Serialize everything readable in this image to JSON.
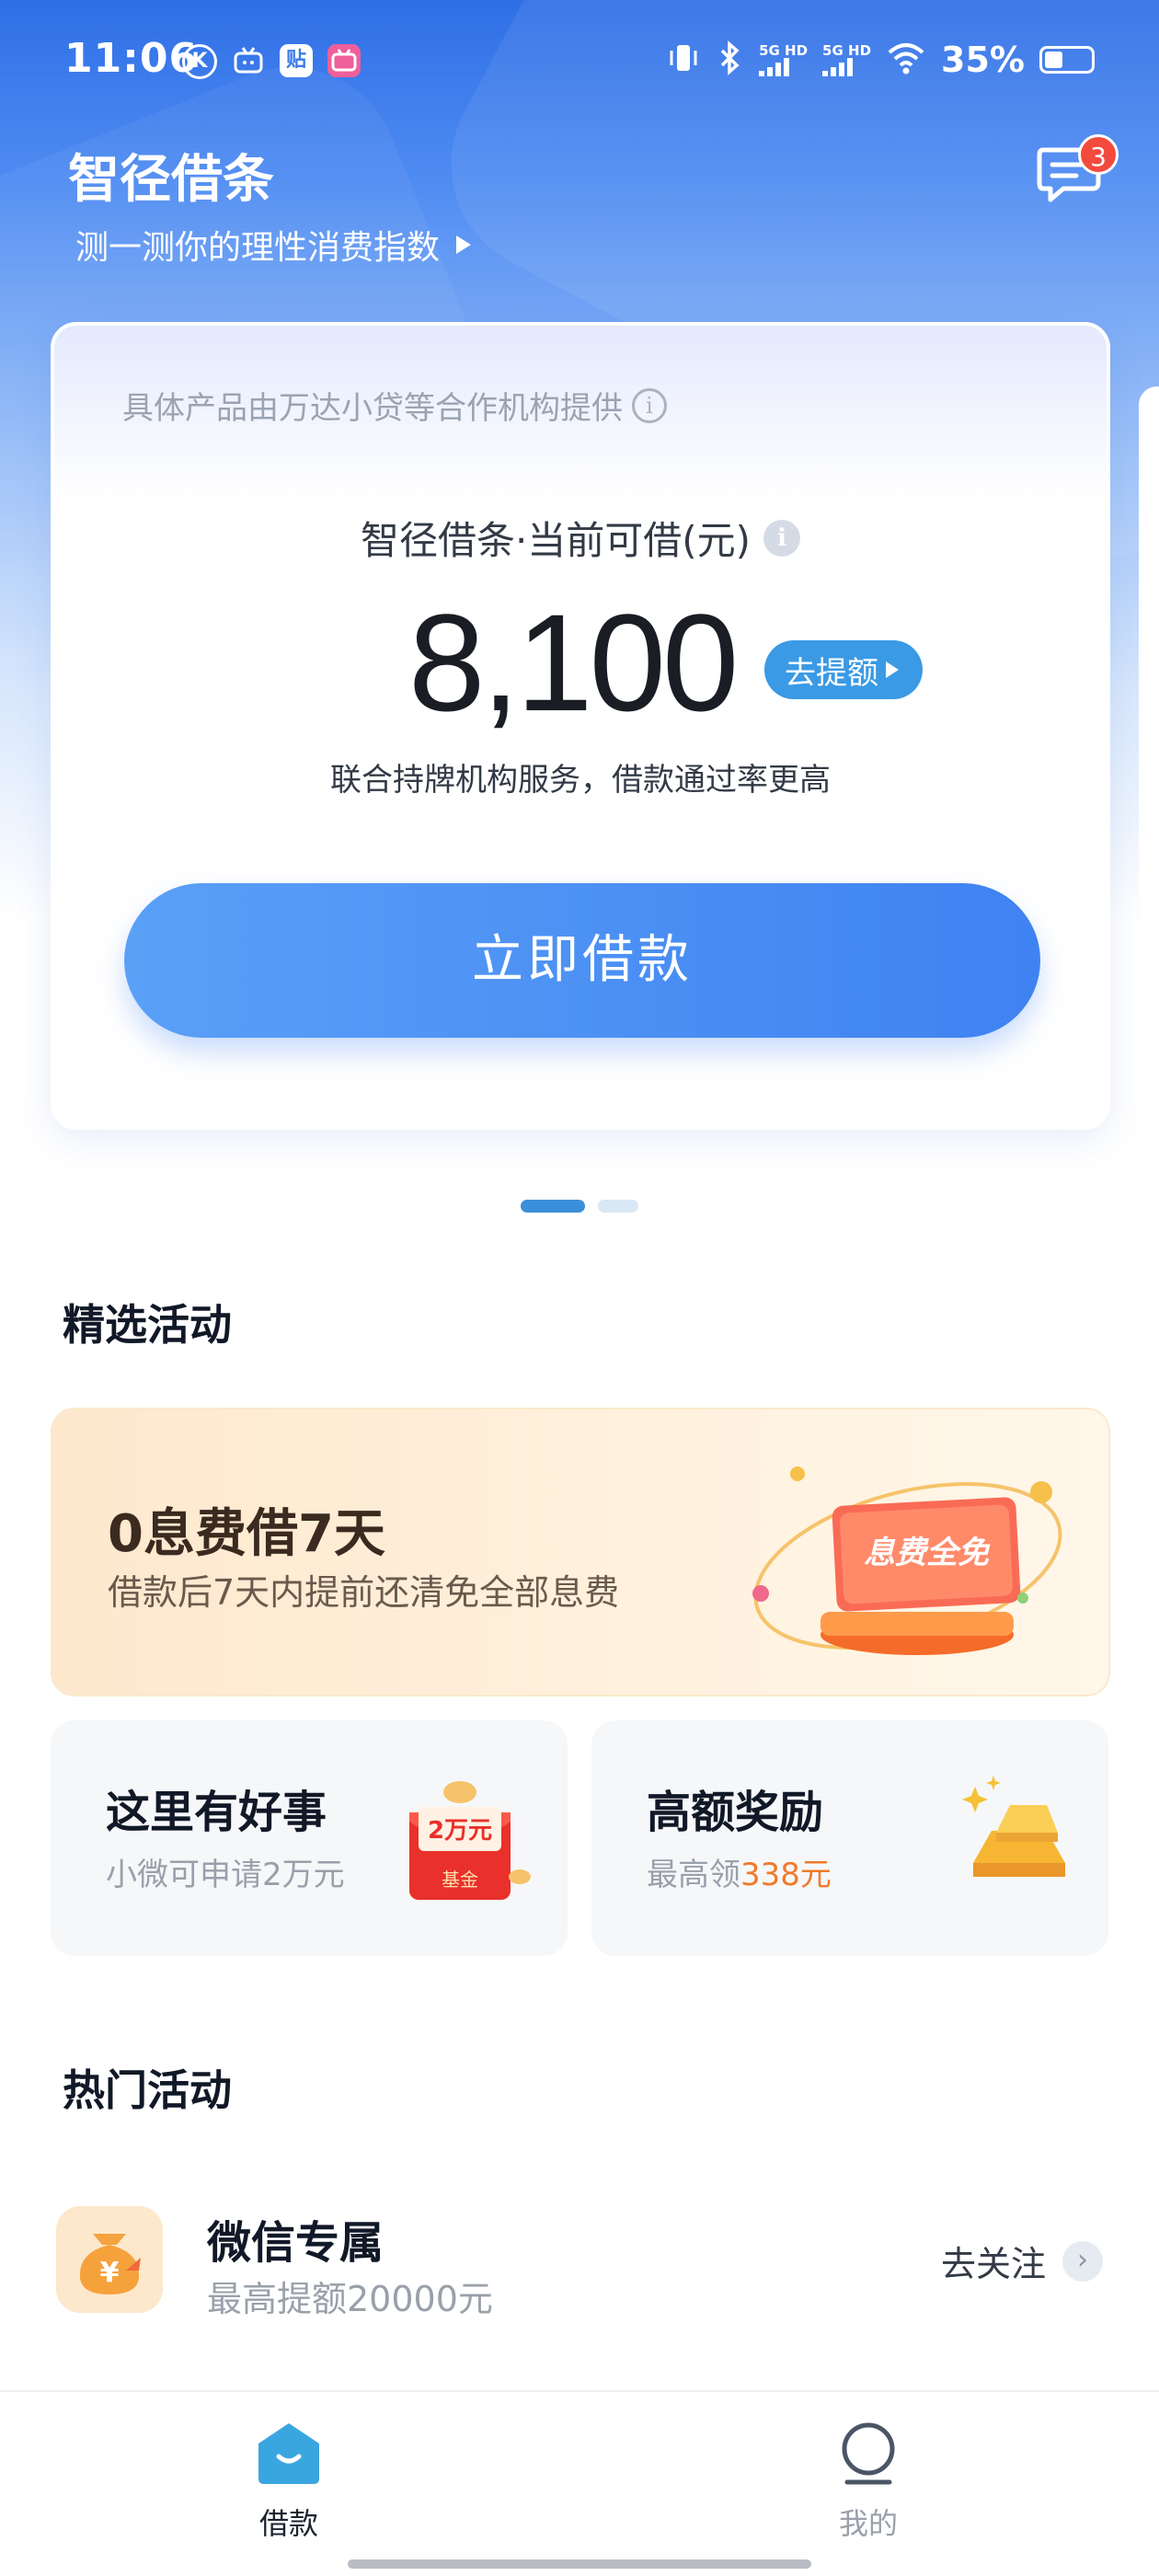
{
  "status_bar": {
    "time": "11:06",
    "app_icons": [
      "K",
      "tv",
      "贴",
      "bili"
    ],
    "signal1_label": "5G HD",
    "signal2_label": "5G HD",
    "battery": "35%"
  },
  "header": {
    "title": "智径借条",
    "subtitle": "测一测你的理性消费指数",
    "message_badge": "3"
  },
  "loan_card": {
    "provider_note": "具体产品由万达小贷等合作机构提供",
    "available_label": "智径借条·当前可借(元)",
    "amount": "8,100",
    "raise_limit_label": "去提额",
    "note": "联合持牌机构服务，借款通过率更高",
    "borrow_button": "立即借款",
    "page_indicator": {
      "count": 2,
      "active": 1
    }
  },
  "featured": {
    "title": "精选活动",
    "banner": {
      "title": "0息费借7天",
      "desc": "借款后7天内提前还清免全部息费",
      "art_text": "息费全免"
    },
    "cards": [
      {
        "title": "这里有好事",
        "desc": "小微可申请2万元",
        "art_top": "2万元",
        "art_bottom": "基金"
      },
      {
        "title": "高额奖励",
        "desc_prefix": "最高领",
        "desc_highlight": "338元"
      }
    ]
  },
  "hot": {
    "title": "热门活动",
    "items": [
      {
        "title": "微信专属",
        "desc": "最高提额20000元",
        "action": "去关注"
      }
    ]
  },
  "tabbar": {
    "items": [
      {
        "label": "借款",
        "active": true
      },
      {
        "label": "我的",
        "active": false
      }
    ]
  },
  "colors": {
    "primary_blue": "#3f82f1",
    "accent_orange": "#f07a2b",
    "badge_red": "#f24a3d",
    "tab_active": "#1b2330",
    "tab_inactive": "#9aa0aa"
  }
}
